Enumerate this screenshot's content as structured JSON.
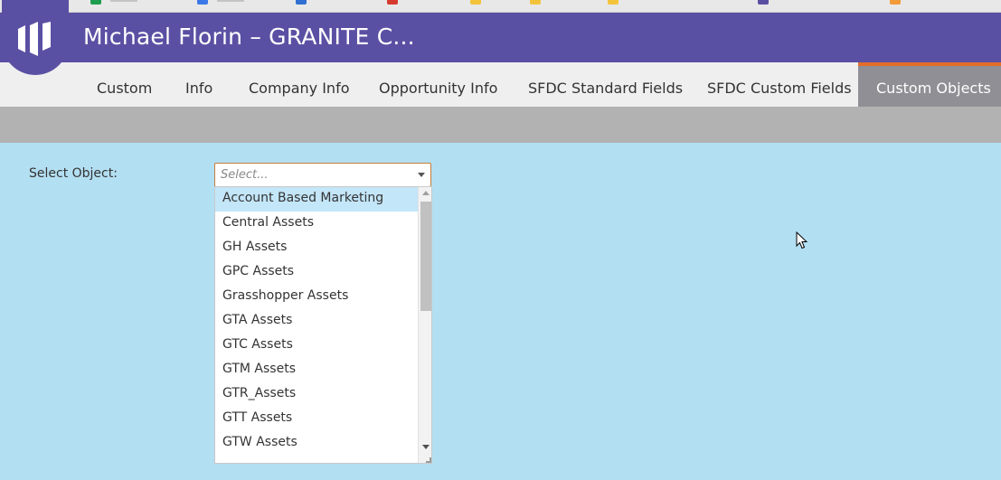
{
  "app": {
    "title": "Michael Florin – GRANITE C..."
  },
  "tabs": [
    {
      "label": "Custom",
      "active": false
    },
    {
      "label": "Info",
      "active": false
    },
    {
      "label": "Company Info",
      "active": false
    },
    {
      "label": "Opportunity Info",
      "active": false
    },
    {
      "label": "SFDC Standard Fields",
      "active": false
    },
    {
      "label": "SFDC Custom Fields",
      "active": false
    },
    {
      "label": "Custom Objects",
      "active": true
    }
  ],
  "form": {
    "select_object_label": "Select Object:",
    "select_placeholder": "Select...",
    "options": [
      "Account Based Marketing",
      "Central Assets",
      "GH Assets",
      "GPC Assets",
      "Grasshopper Assets",
      "GTA Assets",
      "GTC Assets",
      "GTM Assets",
      "GTR_Assets",
      "GTT Assets",
      "GTW Assets"
    ],
    "highlighted_option": "Account Based Marketing"
  },
  "colors": {
    "header": "#5a50a3",
    "accent": "#e46d2a",
    "content_bg": "#b3dff2",
    "highlight": "#c3e6f8"
  },
  "icons": {
    "logo": "marketo-logo-icon",
    "cursor": "mouse-pointer-icon"
  }
}
